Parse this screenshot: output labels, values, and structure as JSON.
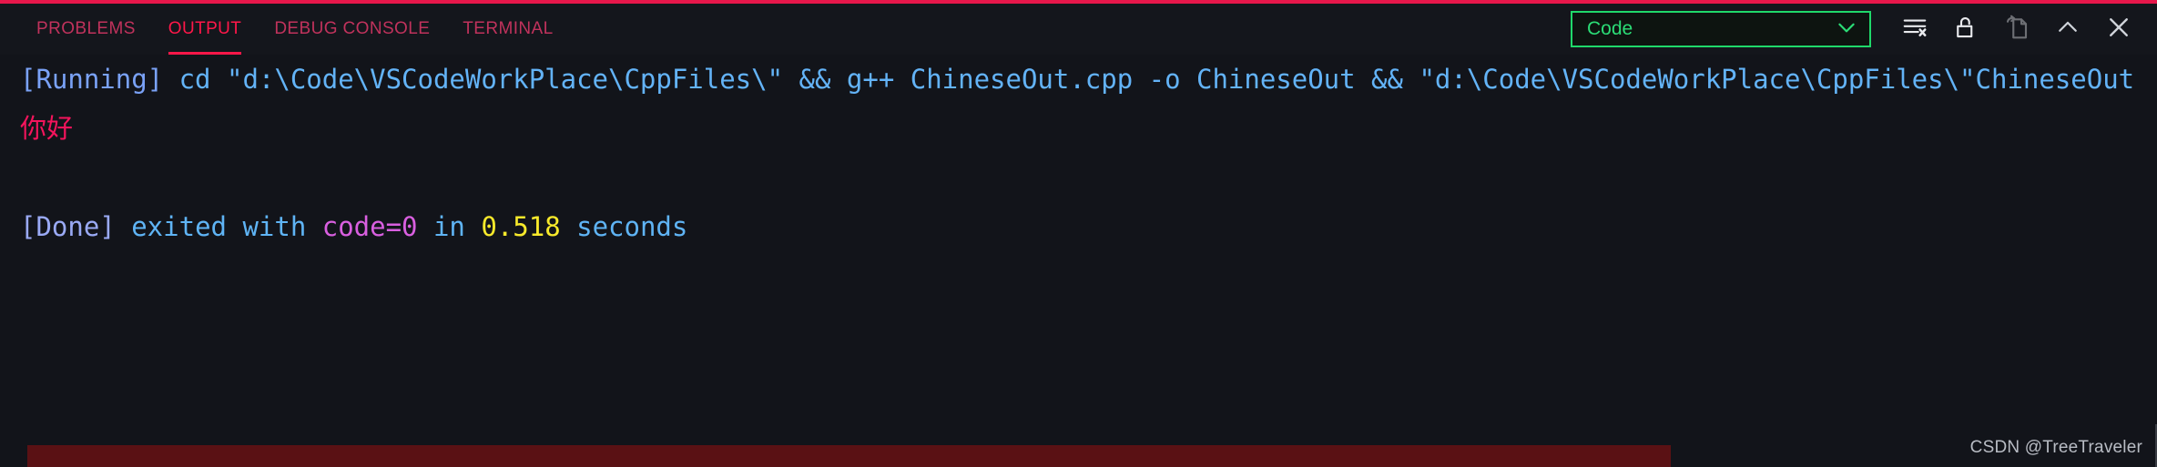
{
  "panel": {
    "tabs": [
      {
        "label": "PROBLEMS",
        "active": false
      },
      {
        "label": "OUTPUT",
        "active": true
      },
      {
        "label": "DEBUG CONSOLE",
        "active": false
      },
      {
        "label": "TERMINAL",
        "active": false
      }
    ],
    "accent_color": "#ff1749",
    "inactive_tab_color": "#c0325c"
  },
  "channel_select": {
    "value": "Code",
    "border_color": "#1fd96a",
    "text_color": "#2bdd76",
    "chevron": "chevron-down"
  },
  "actions": [
    {
      "name": "clear-output-button",
      "title": "Clear Output"
    },
    {
      "name": "unlock-scroll-button",
      "title": "Turn Auto Scrolling Off"
    },
    {
      "name": "open-in-editor-button",
      "title": "Open Output in Editor",
      "disabled": true
    },
    {
      "name": "collapse-panel-button",
      "title": "Maximize Panel Size"
    },
    {
      "name": "close-panel-button",
      "title": "Close Panel"
    }
  ],
  "output": {
    "lines": [
      {
        "segments": [
          {
            "text": "[Running]",
            "style": "t-running"
          },
          {
            "text": " cd \"d:\\Code\\VSCodeWorkPlace\\CppFiles\\\" && g++ ChineseOut.cpp -o ChineseOut && \"d:\\Code\\VSCodeWorkPlace\\CppFiles\\\"ChineseOut",
            "style": "t-cmd"
          }
        ]
      },
      {
        "segments": [
          {
            "text": "你好",
            "style": "t-chinese"
          }
        ]
      },
      {
        "segments": [
          {
            "text": "",
            "style": "t-plain"
          }
        ]
      },
      {
        "segments": [
          {
            "text": "[Done]",
            "style": "t-done"
          },
          {
            "text": " exited with ",
            "style": "t-plain"
          },
          {
            "text": "code=0",
            "style": "t-code"
          },
          {
            "text": " in ",
            "style": "t-plain"
          },
          {
            "text": "0.518",
            "style": "t-num"
          },
          {
            "text": " seconds",
            "style": "t-plain"
          }
        ]
      }
    ]
  },
  "bottom_bar": {
    "color": "#5a1114"
  },
  "watermark": {
    "text": "CSDN @TreeTraveler"
  }
}
